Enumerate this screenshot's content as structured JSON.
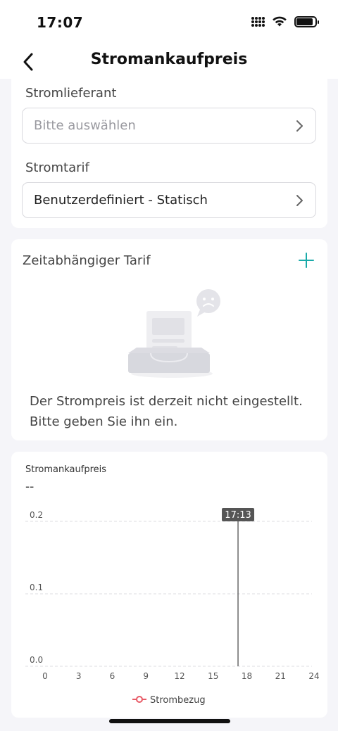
{
  "status_bar": {
    "time": "17:07",
    "battery_level": 0.9
  },
  "nav": {
    "title": "Stromankaufpreis",
    "back_icon": "chevron-left-icon"
  },
  "supplier": {
    "label": "Stromlieferant",
    "placeholder": "Bitte auswählen"
  },
  "tariff": {
    "label": "Stromtarif",
    "value": "Benutzerdefiniert - Statisch"
  },
  "time_tariff": {
    "title": "Zeitabhängiger Tarif",
    "add_icon": "plus-icon",
    "accent": "#1aaaa9",
    "empty_message_line1": "Der Strompreis ist derzeit nicht eingestellt.",
    "empty_message_line2": "Bitte geben Sie ihn ein."
  },
  "chart_card": {
    "title": "Stromankaufpreis",
    "value": "--"
  },
  "chart_data": {
    "type": "line",
    "x_ticks": [
      "0",
      "3",
      "6",
      "9",
      "12",
      "15",
      "18",
      "21",
      "24"
    ],
    "y_ticks": [
      "0.0",
      "0.1",
      "0.2"
    ],
    "xlim": [
      0,
      24
    ],
    "ylim": [
      0,
      0.2
    ],
    "grid": true,
    "cursor": {
      "x": 17.2167,
      "label": "17:13"
    },
    "series": [
      {
        "name": "Strombezug",
        "values": [],
        "color": "#e85a66"
      }
    ],
    "legend_position": "bottom-center"
  }
}
